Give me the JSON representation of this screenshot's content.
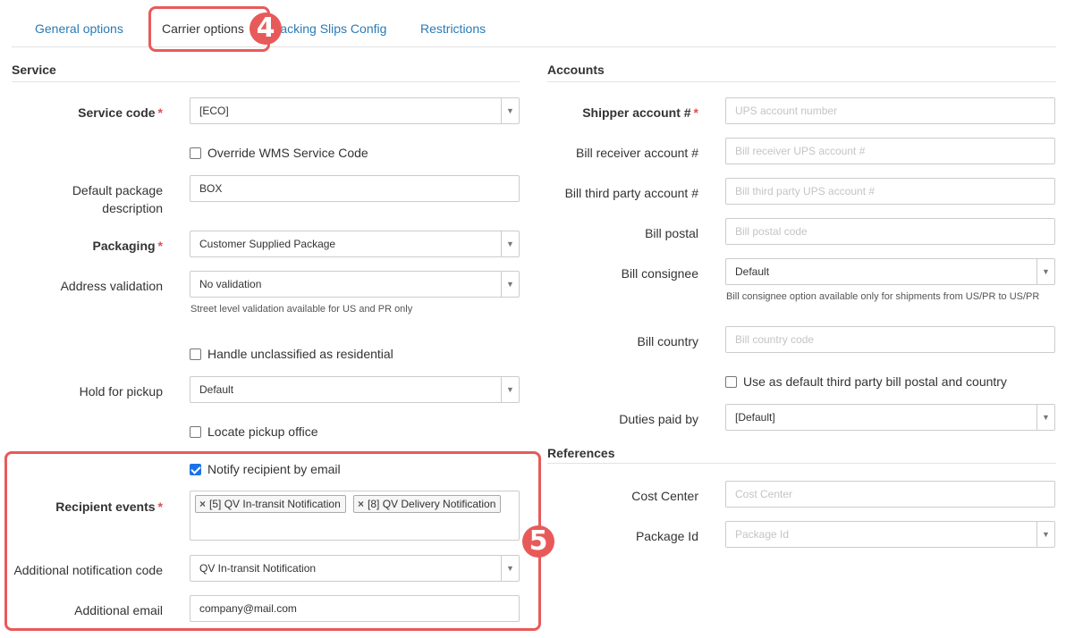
{
  "tabs": [
    {
      "label": "General options"
    },
    {
      "label": "Carrier options"
    },
    {
      "label": "Packing Slips Config"
    },
    {
      "label": "Restrictions"
    }
  ],
  "service": {
    "title": "Service",
    "service_code": {
      "label": "Service code",
      "value": "[ECO]"
    },
    "override_wms": {
      "label": "Override WMS Service Code",
      "checked": false
    },
    "default_package_desc": {
      "label_line1": "Default package",
      "label_line2": "description",
      "value": "BOX"
    },
    "packaging": {
      "label": "Packaging",
      "value": "Customer Supplied Package"
    },
    "address_validation": {
      "label": "Address validation",
      "value": "No validation",
      "help": "Street level validation available for US and PR only"
    },
    "handle_unclassified": {
      "label": "Handle unclassified as residential",
      "checked": false
    },
    "hold_for_pickup": {
      "label": "Hold for pickup",
      "value": "Default"
    },
    "locate_pickup": {
      "label": "Locate pickup office",
      "checked": false
    },
    "notify_email": {
      "label": "Notify recipient by email",
      "checked": true
    },
    "recipient_events": {
      "label": "Recipient events",
      "tags": [
        "[5] QV In-transit Notification",
        "[8] QV Delivery Notification"
      ],
      "remove_icon": "×"
    },
    "additional_notification_code": {
      "label": "Additional notification code",
      "value": "QV In-transit Notification"
    },
    "additional_email": {
      "label": "Additional email",
      "value": "company@mail.com"
    }
  },
  "accounts": {
    "title": "Accounts",
    "shipper_account": {
      "label": "Shipper account #",
      "placeholder": "UPS account number"
    },
    "bill_receiver": {
      "label": "Bill receiver account #",
      "placeholder": "Bill receiver UPS account #"
    },
    "bill_third_party": {
      "label": "Bill third party account #",
      "placeholder": "Bill third party UPS account #"
    },
    "bill_postal": {
      "label": "Bill postal",
      "placeholder": "Bill postal code"
    },
    "bill_consignee": {
      "label": "Bill consignee",
      "value": "Default",
      "help": "Bill consignee option available only for shipments from US/PR to US/PR"
    },
    "bill_country": {
      "label": "Bill country",
      "placeholder": "Bill country code"
    },
    "use_default_third_party": {
      "label": "Use as default third party bill postal and country",
      "checked": false
    },
    "duties_paid_by": {
      "label": "Duties paid by",
      "value": "[Default]"
    }
  },
  "references": {
    "title": "References",
    "cost_center": {
      "label": "Cost Center",
      "placeholder": "Cost Center"
    },
    "package_id": {
      "label": "Package Id",
      "placeholder": "Package Id"
    }
  },
  "annotations": {
    "badge4": "4",
    "badge5": "5",
    "color": "#e85a5a"
  },
  "colors": {
    "link": "#2a7ab5",
    "required": "#d9534f",
    "checkbox_checked": "#1a73e8"
  },
  "icons": {
    "select_arrow": "▼",
    "tag_remove": "×"
  }
}
